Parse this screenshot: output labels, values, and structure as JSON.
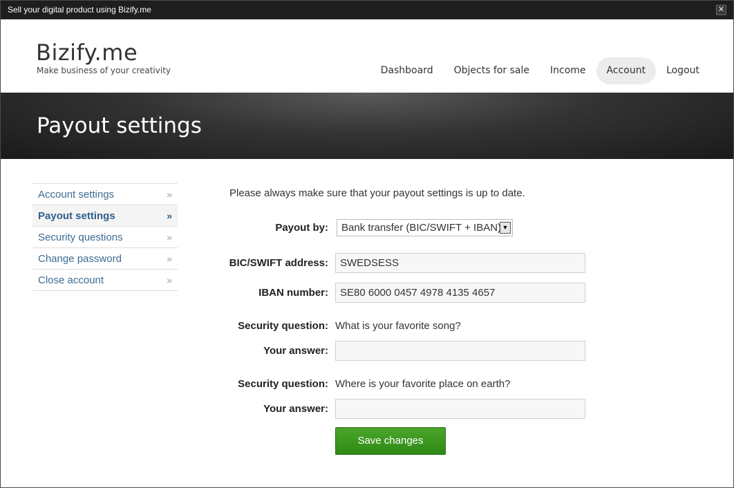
{
  "window": {
    "title": "Sell your digital product using Bizify.me",
    "close_glyph": "✕"
  },
  "header": {
    "logo": "Bizify.me",
    "tagline": "Make business of your creativity",
    "nav": [
      {
        "label": "Dashboard"
      },
      {
        "label": "Objects for sale"
      },
      {
        "label": "Income"
      },
      {
        "label": "Account"
      },
      {
        "label": "Logout"
      }
    ],
    "active_nav": "Account"
  },
  "banner": {
    "title": "Payout settings"
  },
  "sidebar": {
    "items": [
      {
        "label": "Account settings",
        "chevron": "»"
      },
      {
        "label": "Payout settings",
        "chevron": "»"
      },
      {
        "label": "Security questions",
        "chevron": "»"
      },
      {
        "label": "Change password",
        "chevron": "»"
      },
      {
        "label": "Close account",
        "chevron": "»"
      }
    ],
    "active_item": "Payout settings"
  },
  "form": {
    "intro": "Please always make sure that your payout settings is up to date.",
    "payout_by": {
      "label": "Payout by:",
      "value": "Bank transfer (BIC/SWIFT + IBAN)",
      "arrow": "▼"
    },
    "bic": {
      "label": "BIC/SWIFT address:",
      "value": "SWEDSESS"
    },
    "iban": {
      "label": "IBAN number:",
      "value": "SE80 6000 0457 4978 4135 4657"
    },
    "security_1": {
      "question_label": "Security question:",
      "question": "What is your favorite song?",
      "answer_label": "Your answer:",
      "answer": ""
    },
    "security_2": {
      "question_label": "Security question:",
      "question": "Where is your favorite place on earth?",
      "answer_label": "Your answer:",
      "answer": ""
    },
    "save_label": "Save changes"
  },
  "colors": {
    "link": "#3d6b94",
    "save_button": "#3a9a1f",
    "titlebar": "#1e1e1e"
  }
}
